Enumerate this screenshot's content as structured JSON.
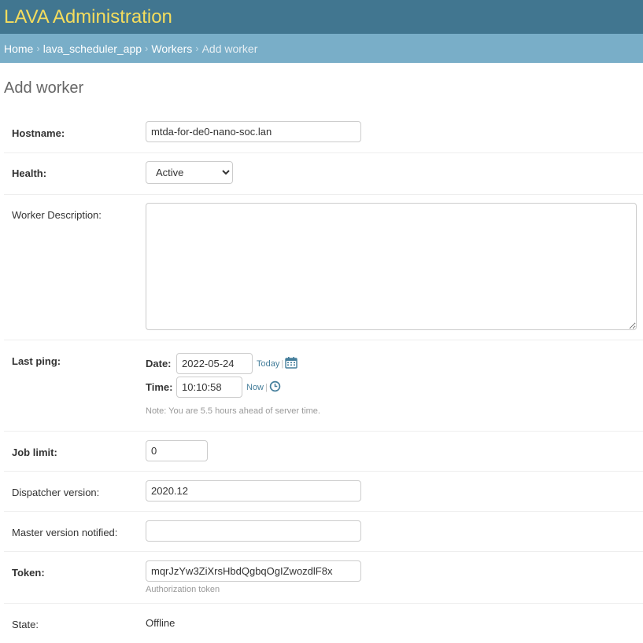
{
  "header": {
    "title": "LAVA Administration"
  },
  "breadcrumbs": {
    "home": "Home",
    "app": "lava_scheduler_app",
    "model": "Workers",
    "current": "Add worker",
    "separator": "›"
  },
  "page": {
    "title": "Add worker"
  },
  "form": {
    "hostname": {
      "label": "Hostname:",
      "value": "mtda-for-de0-nano-soc.lan"
    },
    "health": {
      "label": "Health:",
      "selected": "Active"
    },
    "description": {
      "label": "Worker Description:",
      "value": ""
    },
    "last_ping": {
      "label": "Last ping:",
      "date_label": "Date:",
      "date_value": "2022-05-24",
      "today_link": "Today",
      "time_label": "Time:",
      "time_value": "10:10:58",
      "now_link": "Now",
      "note": "Note: You are 5.5 hours ahead of server time.",
      "calendar_icon": "calendar-icon",
      "clock_icon": "clock-icon"
    },
    "job_limit": {
      "label": "Job limit:",
      "value": "0"
    },
    "dispatcher_version": {
      "label": "Dispatcher version:",
      "value": "2020.12"
    },
    "master_version": {
      "label": "Master version notified:",
      "value": ""
    },
    "token": {
      "label": "Token:",
      "value": "mqrJzYw3ZiXrsHbdQgbqOgIZwozdlF8x",
      "help": "Authorization token"
    },
    "state": {
      "label": "State:",
      "value": "Offline"
    }
  },
  "colors": {
    "header_bg": "#417690",
    "header_title": "#f5dd5d",
    "breadcrumb_bg": "#79aec8",
    "link": "#447e9b"
  }
}
